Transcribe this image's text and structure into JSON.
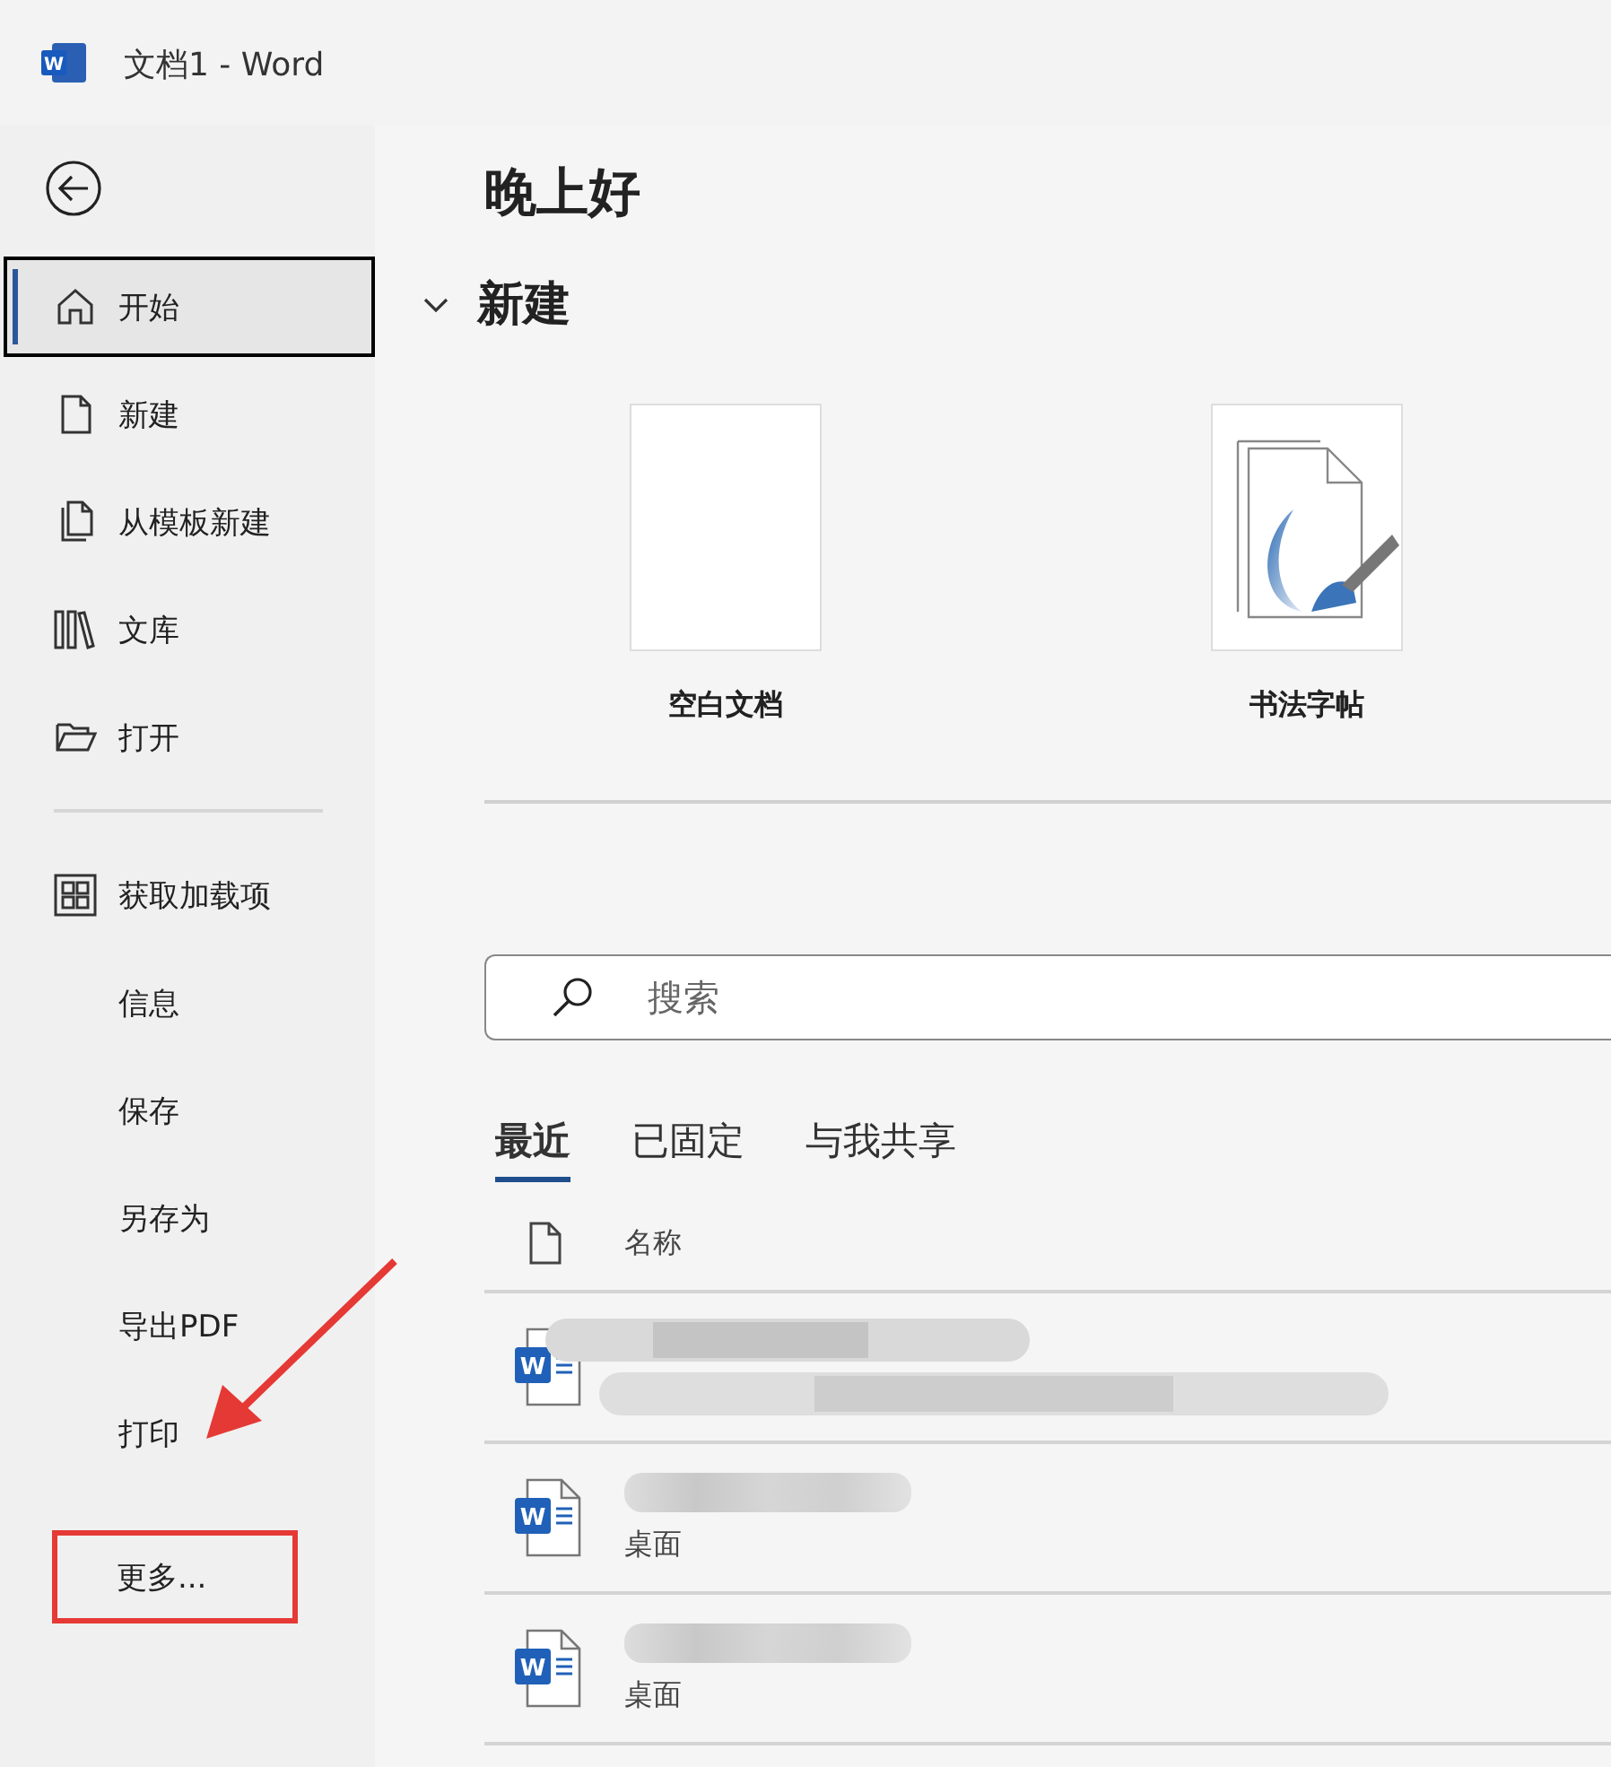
{
  "window": {
    "logo": "W",
    "title": "文档1  -  Word"
  },
  "sidebar": {
    "items": [
      {
        "label": "开始",
        "selected": true,
        "focused": true,
        "highlighted": false
      },
      {
        "label": "新建",
        "selected": false,
        "focused": false,
        "highlighted": false
      },
      {
        "label": "从模板新建",
        "selected": false,
        "focused": false,
        "highlighted": false
      },
      {
        "label": "文库",
        "selected": false,
        "focused": false,
        "highlighted": false
      },
      {
        "label": "打开",
        "selected": false,
        "focused": false,
        "highlighted": false
      },
      {
        "kind": "divider"
      },
      {
        "label": "获取加载项",
        "selected": false,
        "focused": false,
        "highlighted": false
      },
      {
        "label": "信息",
        "selected": false,
        "focused": false,
        "highlighted": false
      },
      {
        "label": "保存",
        "selected": false,
        "focused": false,
        "highlighted": false
      },
      {
        "label": "另存为",
        "selected": false,
        "focused": false,
        "highlighted": false
      },
      {
        "label": "导出PDF",
        "selected": false,
        "focused": false,
        "highlighted": false
      },
      {
        "label": "打印",
        "selected": false,
        "focused": false,
        "highlighted": false
      },
      {
        "kind": "spacer"
      },
      {
        "label": "更多...",
        "selected": false,
        "focused": false,
        "highlighted": true
      }
    ]
  },
  "greeting": "晚上好",
  "new_section": {
    "title": "新建",
    "expanded": true,
    "templates": [
      {
        "label": "空白文档",
        "kind": "blank"
      },
      {
        "label": "书法字帖",
        "kind": "calligraphy"
      }
    ]
  },
  "search": {
    "placeholder": "搜索"
  },
  "tabs": [
    {
      "label": "最近",
      "selected": true
    },
    {
      "label": "已固定",
      "selected": false
    },
    {
      "label": "与我共享",
      "selected": false
    }
  ],
  "file_list": {
    "columns": [
      "名称"
    ],
    "rows": [
      {
        "kind": "blurred",
        "icon_letter": "W"
      },
      {
        "kind": "name_blurred",
        "icon_letter": "W",
        "location": "桌面"
      },
      {
        "kind": "name_blurred",
        "icon_letter": "W",
        "location": "桌面"
      }
    ]
  },
  "annotations": [
    {
      "kind": "arrow"
    }
  ]
}
